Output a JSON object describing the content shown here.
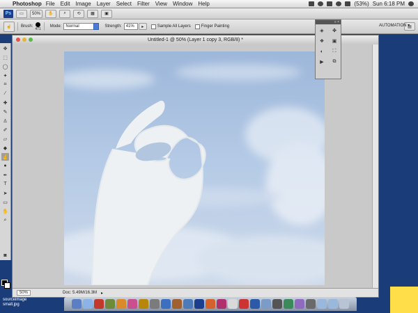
{
  "menubar": {
    "app_name": "Photoshop",
    "items": [
      "File",
      "Edit",
      "Image",
      "Layer",
      "Select",
      "Filter",
      "View",
      "Window",
      "Help"
    ],
    "battery": "(53%)",
    "clock": "Sun 6:18 PM"
  },
  "options": {
    "zoom": "50%",
    "brush_label": "Brush:",
    "brush_size": "471",
    "mode_label": "Mode:",
    "mode_value": "Normal",
    "strength_label": "Strength:",
    "strength_value": "41%",
    "sample_all_layers": "Sample All Layers",
    "finger_painting": "Finger Painting",
    "workspace": "AUTOMATION ▾"
  },
  "document": {
    "title": "Untitled-1 @ 50% (Layer 1 copy 3, RGB/8) *",
    "status_zoom": "50%",
    "status_doc": "Doc: 5.49M/16.3M"
  },
  "desktop": {
    "file_label_line1": "sourceimage",
    "file_label_line2": "small.jpg"
  },
  "colors": {
    "ps_blue": "#1b3f8f",
    "sky_light": "#c6d4e8",
    "sky_dark": "#9cb6d8",
    "desktop_blue": "#1a3d7a",
    "hand": "#eef1f3"
  },
  "tools": [
    "move-icon",
    "marquee-icon",
    "lasso-icon",
    "magic-wand-icon",
    "crop-icon",
    "eyedropper-icon",
    "healing-icon",
    "brush-icon",
    "stamp-icon",
    "history-brush-icon",
    "eraser-icon",
    "bucket-icon",
    "smudge-icon",
    "dodge-icon",
    "pen-icon",
    "type-icon",
    "path-select-icon",
    "shape-icon",
    "hand-icon",
    "zoom-icon"
  ]
}
